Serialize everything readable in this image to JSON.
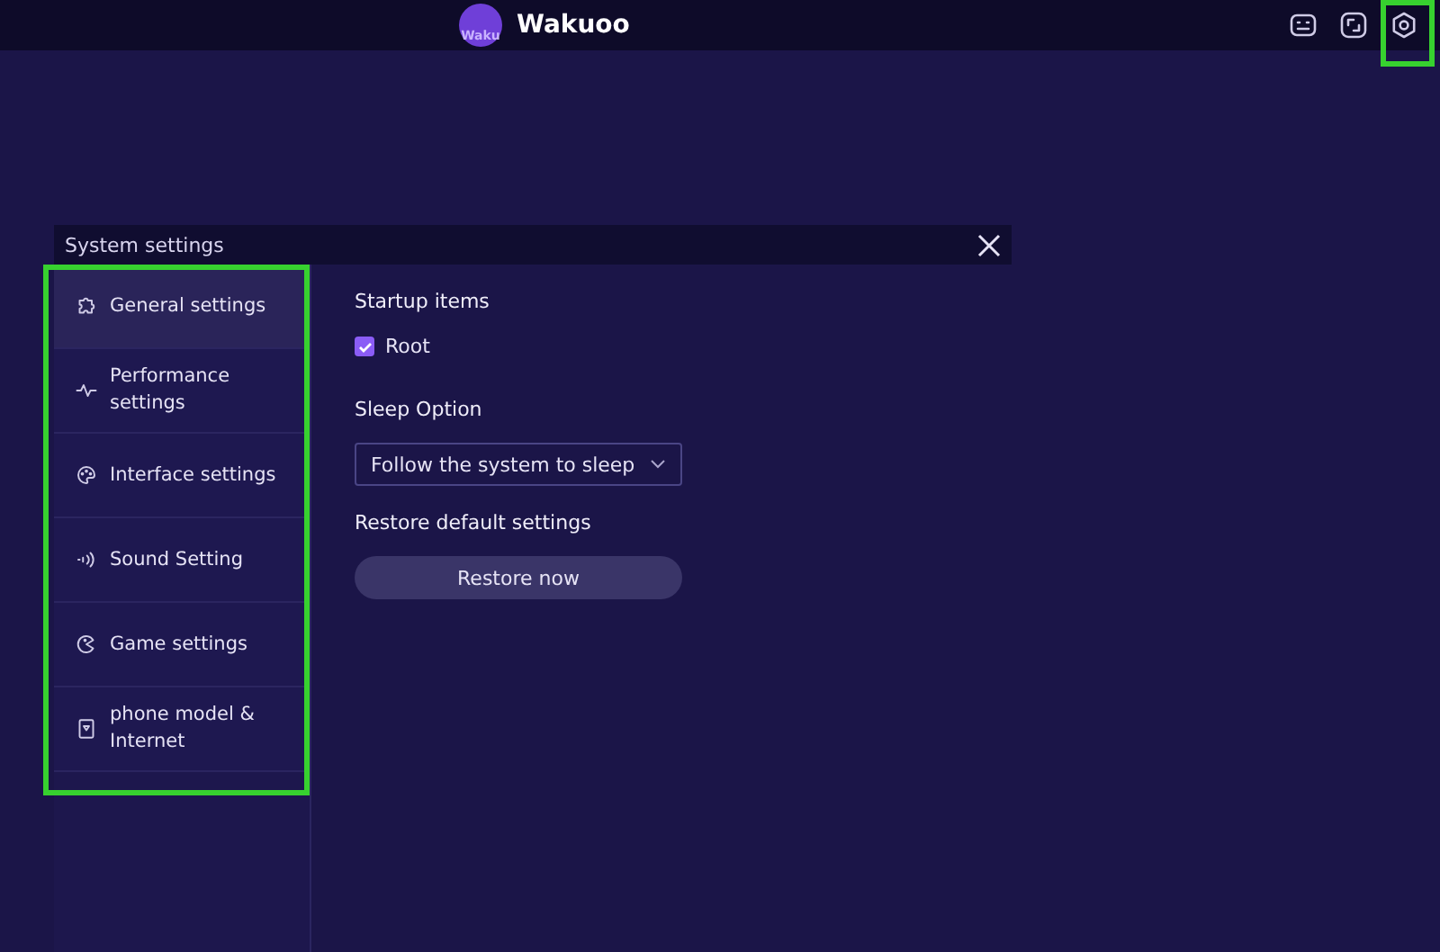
{
  "app": {
    "logo_text": "Waku",
    "title": "Wakuoo"
  },
  "dialog": {
    "title": "System settings",
    "sidebar": {
      "items": [
        {
          "label": "General settings",
          "selected": true
        },
        {
          "label": "Performance settings",
          "selected": false
        },
        {
          "label": "Interface settings",
          "selected": false
        },
        {
          "label": "Sound Setting",
          "selected": false
        },
        {
          "label": "Game settings",
          "selected": false
        },
        {
          "label": "phone model & Internet",
          "selected": false
        }
      ]
    },
    "startup_items": {
      "heading": "Startup items",
      "checkbox": {
        "label": "Root",
        "checked": true
      }
    },
    "sleep_option": {
      "heading": "Sleep Option",
      "value": "Follow the system to sleep"
    },
    "restore": {
      "heading": "Restore default settings",
      "button": "Restore now"
    }
  }
}
